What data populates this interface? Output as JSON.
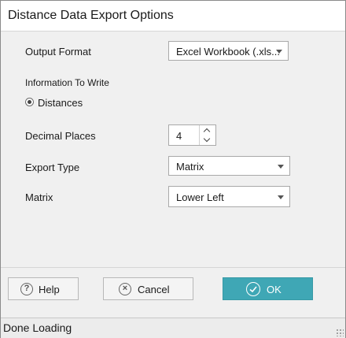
{
  "dialog": {
    "title": "Distance Data Export Options"
  },
  "form": {
    "output_format": {
      "label": "Output Format",
      "value": "Excel Workbook (.xls..."
    },
    "information_to_write": {
      "label": "Information To Write",
      "option_label": "Distances",
      "selected": true
    },
    "decimal_places": {
      "label": "Decimal Places",
      "value": "4"
    },
    "export_type": {
      "label": "Export Type",
      "value": "Matrix"
    },
    "matrix": {
      "label": "Matrix",
      "value": "Lower Left"
    }
  },
  "buttons": {
    "help": {
      "label": "Help",
      "icon": "help-icon"
    },
    "cancel": {
      "label": "Cancel",
      "icon": "close-icon"
    },
    "ok": {
      "label": "OK",
      "icon": "check-icon"
    }
  },
  "colors": {
    "ok_accent": "#3fa7b5"
  },
  "status": {
    "text": "Done Loading"
  }
}
